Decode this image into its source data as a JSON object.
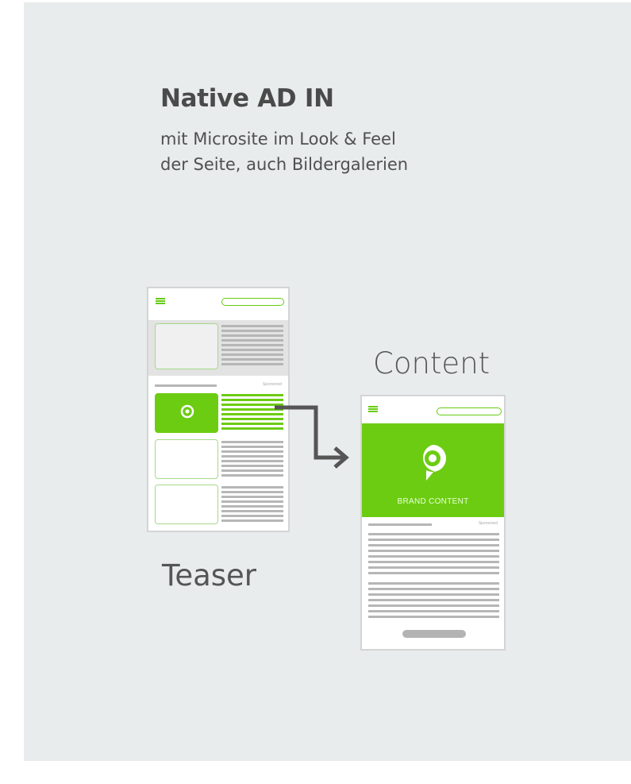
{
  "header": {
    "title": "Native AD IN",
    "subtitle_line1": "mit Microsite im Look & Feel",
    "subtitle_line2": "der Seite, auch Bildergalerien"
  },
  "labels": {
    "content": "Content",
    "teaser": "Teaser"
  },
  "teaser_phone": {
    "sponsored_label": "Sponsored"
  },
  "content_phone": {
    "hero_caption": "BRAND CONTENT",
    "sponsored_label": "Sponsored"
  },
  "icons": {
    "menu": "hamburger-menu-icon",
    "brand": "location-pin-icon"
  },
  "colors": {
    "accent_green": "#6ccc12",
    "panel_bg": "#e8ecec",
    "arrow": "#555555"
  }
}
